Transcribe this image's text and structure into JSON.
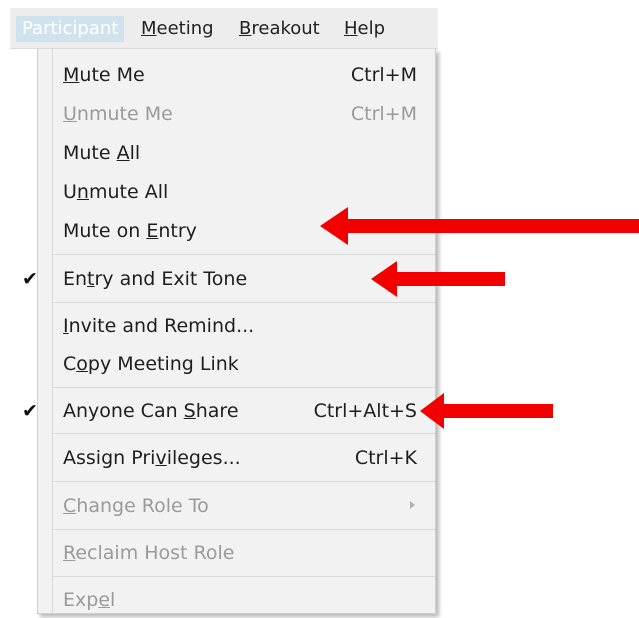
{
  "menubar": {
    "items": [
      {
        "pre": "",
        "ul": "",
        "post": "Participant"
      },
      {
        "pre": "",
        "ul": "M",
        "post": "eeting"
      },
      {
        "pre": "",
        "ul": "B",
        "post": "reakout"
      },
      {
        "pre": "",
        "ul": "H",
        "post": "elp"
      }
    ]
  },
  "menu": {
    "items": [
      {
        "pre": "",
        "ul": "M",
        "post": "ute Me",
        "shortcut": "Ctrl+M"
      },
      {
        "pre": "",
        "ul": "U",
        "post": "nmute Me",
        "shortcut": "Ctrl+M"
      },
      {
        "pre": "Mute ",
        "ul": "A",
        "post": "ll",
        "shortcut": ""
      },
      {
        "pre": "U",
        "ul": "n",
        "post": "mute All",
        "shortcut": ""
      },
      {
        "pre": "Mute on ",
        "ul": "E",
        "post": "ntry",
        "shortcut": ""
      },
      {
        "pre": "En",
        "ul": "t",
        "post": "ry and Exit Tone",
        "shortcut": ""
      },
      {
        "pre": "",
        "ul": "I",
        "post": "nvite and Remind...",
        "shortcut": ""
      },
      {
        "pre": "C",
        "ul": "o",
        "post": "py Meeting Link",
        "shortcut": ""
      },
      {
        "pre": "Anyone Can ",
        "ul": "S",
        "post": "hare",
        "shortcut": "Ctrl+Alt+S"
      },
      {
        "pre": "Assign Pri",
        "ul": "v",
        "post": "ileges...",
        "shortcut": "Ctrl+K"
      },
      {
        "pre": "",
        "ul": "C",
        "post": "hange Role To",
        "shortcut": ""
      },
      {
        "pre": "",
        "ul": "R",
        "post": "eclaim Host Role",
        "shortcut": ""
      },
      {
        "pre": "Exp",
        "ul": "e",
        "post": "l",
        "shortcut": ""
      }
    ],
    "checkmark": "✔"
  },
  "colors": {
    "annotation_arrow": "#f20000",
    "menu_background": "#f2f2f2",
    "menubar_background": "#ededed",
    "active_menubar_highlight": "#cfe3ef",
    "disabled_text": "#9a9a9a"
  }
}
